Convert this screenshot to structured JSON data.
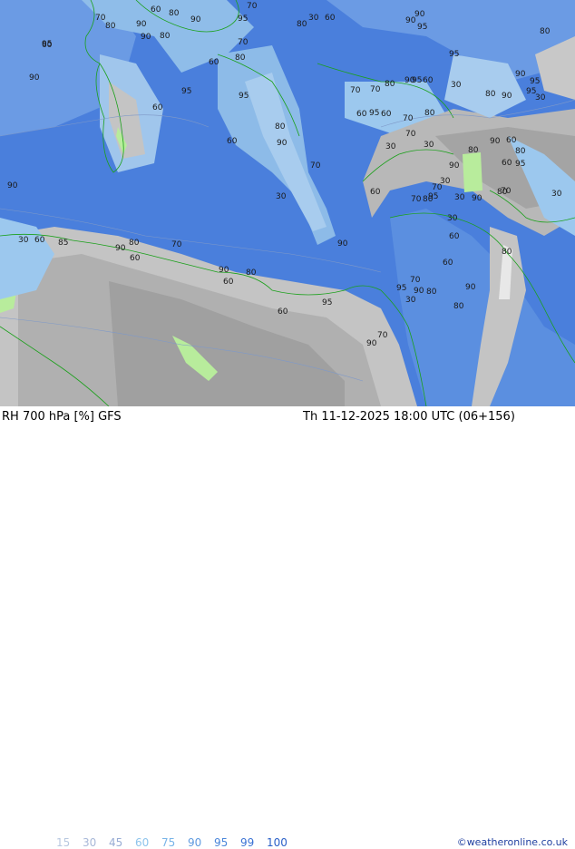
{
  "footer": {
    "title": "RH 700 hPa [%] GFS",
    "datetime": "Th 11-12-2025 18:00 UTC (06+156)",
    "credit": "©weatheronline.co.uk"
  },
  "legend": [
    {
      "label": "15",
      "color": "#b8c8e0"
    },
    {
      "label": "30",
      "color": "#a8b8d8"
    },
    {
      "label": "45",
      "color": "#98acd4"
    },
    {
      "label": "60",
      "color": "#8ec4ec"
    },
    {
      "label": "75",
      "color": "#78b4e8"
    },
    {
      "label": "90",
      "color": "#5f9be0"
    },
    {
      "label": "95",
      "color": "#4a86da"
    },
    {
      "label": "99",
      "color": "#3a72d4"
    },
    {
      "label": "100",
      "color": "#2a60c8"
    }
  ],
  "colors": {
    "rh_high": "#3f6fd8",
    "rh_mid": "#5b8fe0",
    "rh_light": "#9cc8ee",
    "dry_light": "#d8d8d8",
    "dry_mid": "#b8b8b8",
    "dry_dark": "#a0a0a0",
    "very_dry": "#b8ec9c",
    "coastline": "#1aa01a"
  },
  "contour_labels": [
    "60",
    "80",
    "90",
    "90",
    "95",
    "70",
    "80",
    "90",
    "60",
    "80",
    "95",
    "70",
    "95",
    "60",
    "80",
    "70",
    "95",
    "90",
    "60",
    "30",
    "60",
    "80",
    "90",
    "95",
    "90",
    "80",
    "95",
    "90",
    "95",
    "70",
    "60",
    "70",
    "80",
    "90",
    "95",
    "60",
    "30",
    "95",
    "80",
    "70",
    "60",
    "90",
    "80",
    "95",
    "70",
    "80",
    "90",
    "60",
    "30",
    "30",
    "90",
    "30",
    "60",
    "90",
    "80",
    "95",
    "30",
    "70",
    "60",
    "70",
    "80",
    "95",
    "30",
    "90",
    "80",
    "70",
    "30",
    "60",
    "80",
    "70",
    "90",
    "30",
    "60",
    "85",
    "90",
    "80",
    "60",
    "70",
    "90",
    "80",
    "60",
    "95",
    "70",
    "90",
    "80",
    "60",
    "30",
    "60",
    "80",
    "90",
    "30",
    "95",
    "60",
    "90",
    "70",
    "30",
    "80",
    "90"
  ]
}
